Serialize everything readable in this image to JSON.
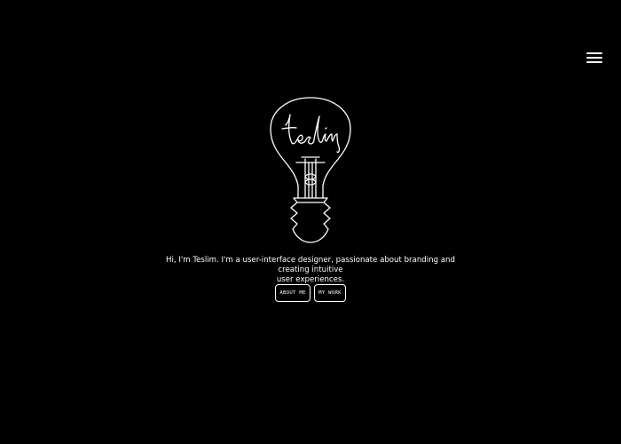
{
  "nav": {
    "menu_icon": "hamburger-icon"
  },
  "hero": {
    "logo_text": "teslim",
    "logo_icon": "lightbulb-icon",
    "intro_line1": "Hi, I'm Teslim. I'm a user-interface designer, passionate about branding and creating intuitive",
    "intro_line2": "user experiences."
  },
  "actions": {
    "about_label": "ABOUT ME",
    "work_label": "MY WORK"
  },
  "colors": {
    "background": "#000000",
    "foreground": "#ffffff"
  }
}
